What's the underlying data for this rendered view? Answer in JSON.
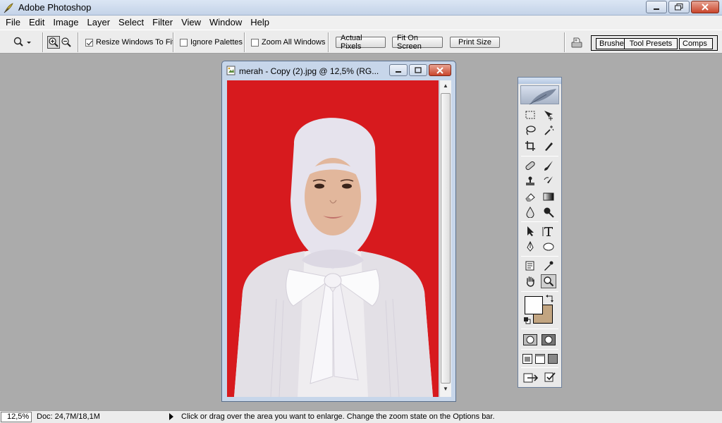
{
  "app": {
    "title": "Adobe Photoshop"
  },
  "menu": [
    "File",
    "Edit",
    "Image",
    "Layer",
    "Select",
    "Filter",
    "View",
    "Window",
    "Help"
  ],
  "options": {
    "resize_windows": {
      "label": "Resize Windows To Fit",
      "checked": true
    },
    "ignore_palettes": {
      "label": "Ignore Palettes",
      "checked": false
    },
    "zoom_all_windows": {
      "label": "Zoom All Windows",
      "checked": false
    },
    "actual_pixels": "Actual Pixels",
    "fit_on_screen": "Fit On Screen",
    "print_size": "Print Size"
  },
  "palette_well": {
    "tabs": [
      "Brushes",
      "Tool Presets",
      "Comps"
    ]
  },
  "document": {
    "title": "merah - Copy (2).jpg @ 12,5% (RG...",
    "background_color": "#d71a1e"
  },
  "toolbox": {
    "foreground_color": "#fefefe",
    "background_color": "#c2a581",
    "tools": [
      "marquee-tool",
      "move-tool",
      "lasso-tool",
      "magic-wand-tool",
      "crop-tool",
      "slice-tool",
      "healing-brush-tool",
      "brush-tool",
      "clone-stamp-tool",
      "history-brush-tool",
      "eraser-tool",
      "gradient-tool",
      "blur-tool",
      "dodge-tool",
      "path-selection-tool",
      "type-tool",
      "pen-tool",
      "shape-tool",
      "notes-tool",
      "eyedropper-tool",
      "hand-tool",
      "zoom-tool"
    ],
    "active_tool": "zoom-tool"
  },
  "status": {
    "zoom": "12,5%",
    "doc": "Doc: 24,7M/18,1M",
    "hint": "Click or drag over the area you want to enlarge. Change the zoom state on the Options bar."
  }
}
